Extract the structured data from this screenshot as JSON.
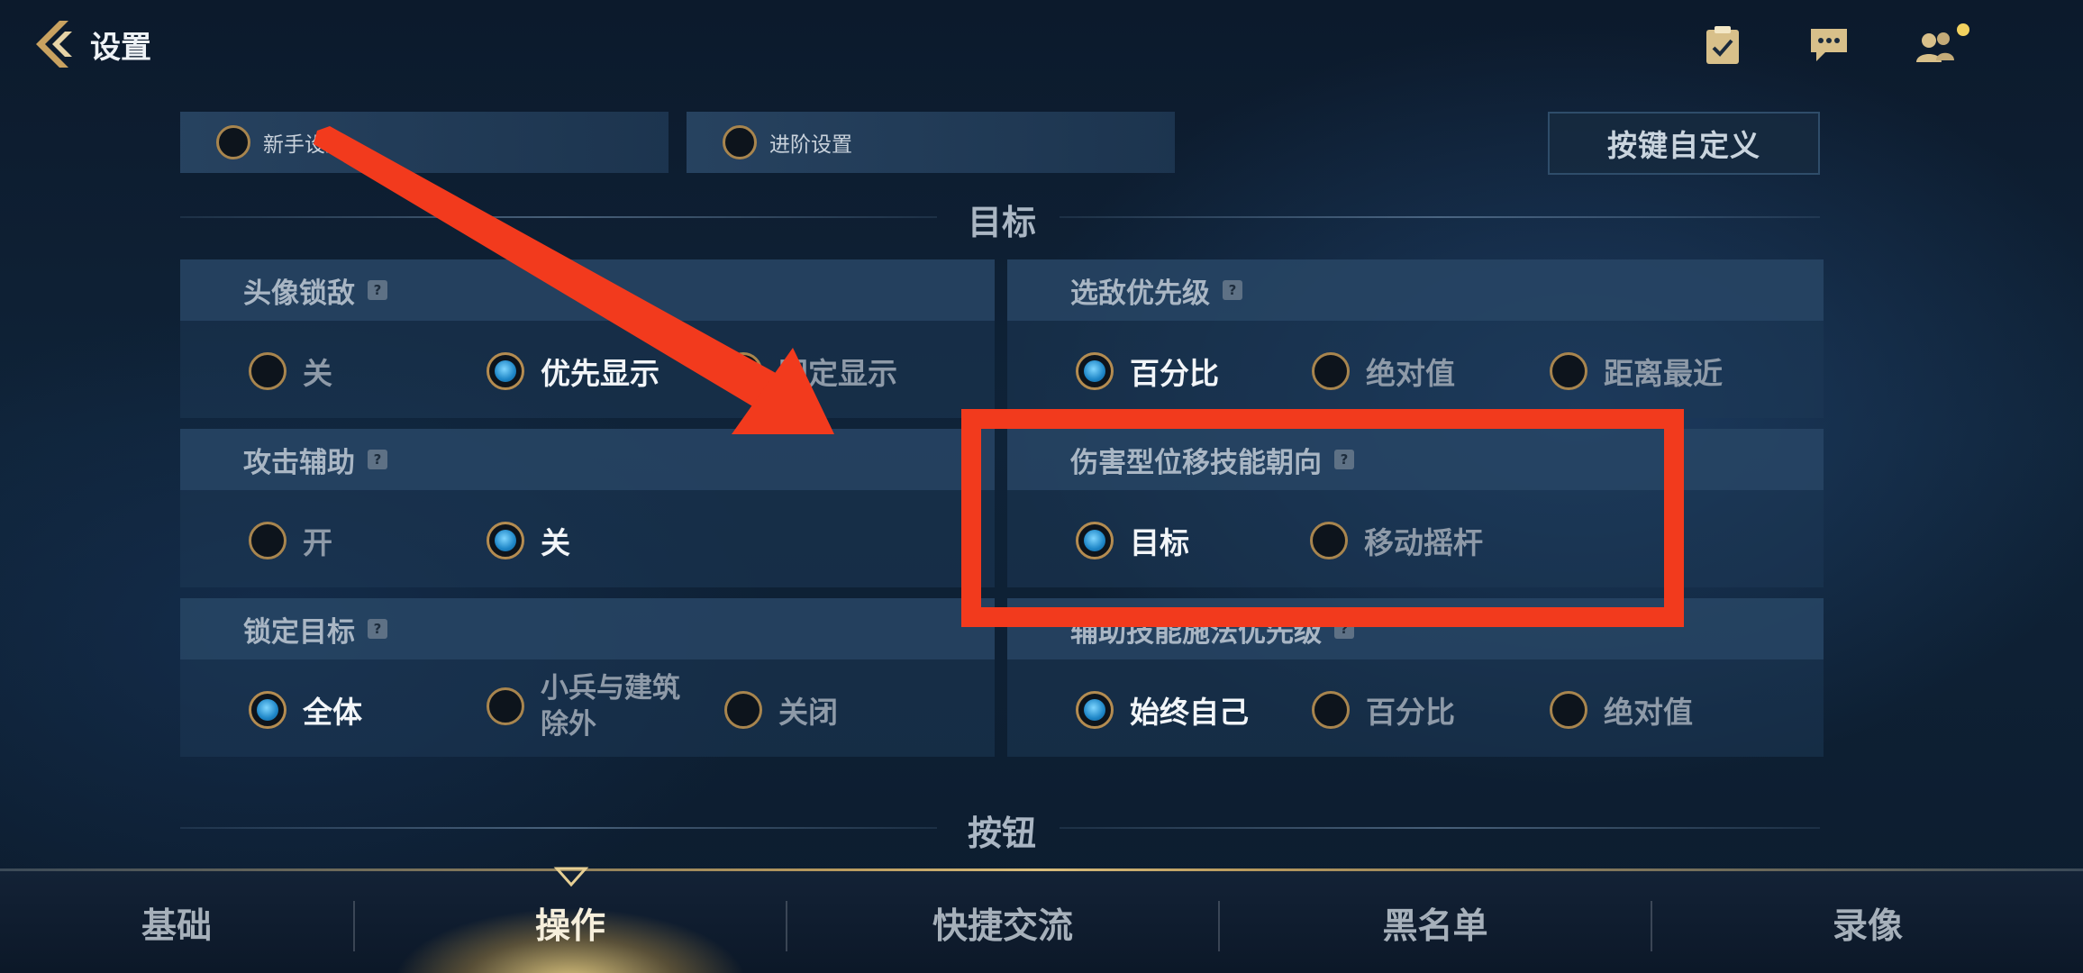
{
  "header": {
    "title": "设置",
    "icons": [
      "tasks-icon",
      "chat-icon",
      "friends-icon"
    ]
  },
  "modes": [
    {
      "label": "新手设置",
      "selected": false
    },
    {
      "label": "进阶设置",
      "selected": false
    }
  ],
  "custom_keys_button": "按键自定义",
  "sections": {
    "target_title": "目标",
    "button_title": "按钮"
  },
  "settings": {
    "avatar_lock": {
      "title": "头像锁敌",
      "options": [
        {
          "label": "关",
          "selected": false
        },
        {
          "label": "优先显示",
          "selected": true
        },
        {
          "label": "固定显示",
          "selected": false
        }
      ]
    },
    "target_priority": {
      "title": "选敌优先级",
      "options": [
        {
          "label": "百分比",
          "selected": true
        },
        {
          "label": "绝对值",
          "selected": false
        },
        {
          "label": "距离最近",
          "selected": false
        }
      ]
    },
    "attack_assist": {
      "title": "攻击辅助",
      "options": [
        {
          "label": "开",
          "selected": false
        },
        {
          "label": "关",
          "selected": true
        }
      ]
    },
    "damage_skill_direction": {
      "title": "伤害型位移技能朝向",
      "options": [
        {
          "label": "目标",
          "selected": true
        },
        {
          "label": "移动摇杆",
          "selected": false
        }
      ]
    },
    "lock_target": {
      "title": "锁定目标",
      "options": [
        {
          "label": "全体",
          "selected": true
        },
        {
          "label": "小兵与建筑除外",
          "selected": false
        },
        {
          "label": "关闭",
          "selected": false
        }
      ]
    },
    "assist_skill_priority": {
      "title": "辅助技能施法优先级",
      "options": [
        {
          "label": "始终自己",
          "selected": true
        },
        {
          "label": "百分比",
          "selected": false
        },
        {
          "label": "绝对值",
          "selected": false
        }
      ]
    }
  },
  "help_glyph": "?",
  "bottom_tabs": [
    {
      "label": "基础",
      "active": false
    },
    {
      "label": "操作",
      "active": true
    },
    {
      "label": "快捷交流",
      "active": false
    },
    {
      "label": "黑名单",
      "active": false
    },
    {
      "label": "录像",
      "active": false
    }
  ],
  "colors": {
    "accent_gold": "#b48c51",
    "selected_blue": "#1e86c7",
    "annotation_red": "#f23a1d"
  }
}
